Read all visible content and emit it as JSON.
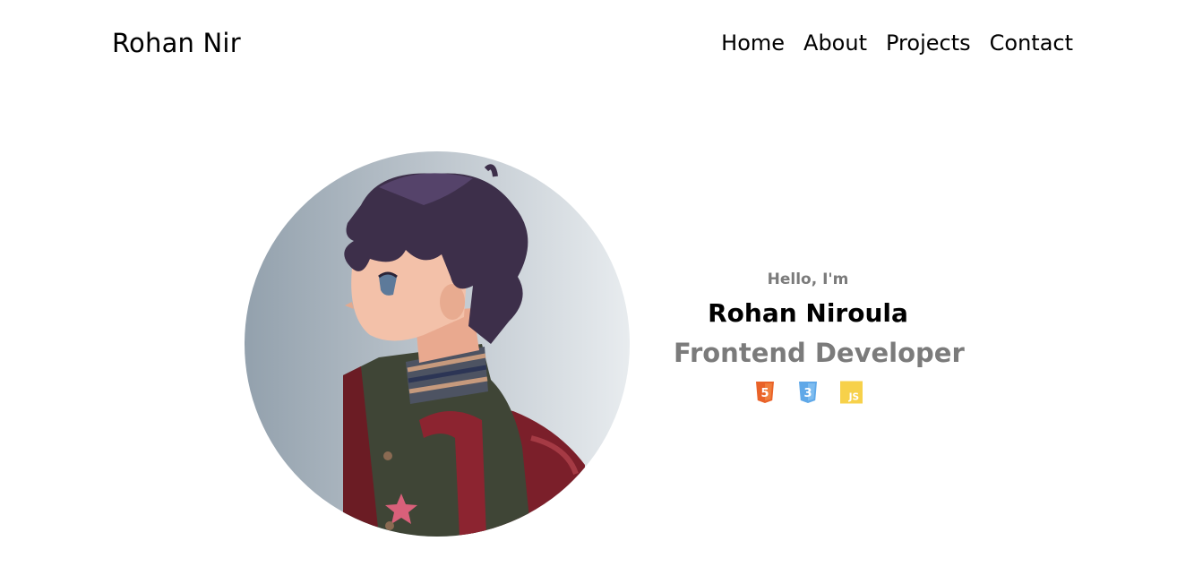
{
  "header": {
    "brand": "Rohan Nir",
    "nav": [
      {
        "label": "Home"
      },
      {
        "label": "About"
      },
      {
        "label": "Projects"
      },
      {
        "label": "Contact"
      }
    ]
  },
  "hero": {
    "avatar_icon": "anime-boy-profile-illustration",
    "greeting": "Hello, I'm",
    "name": "Rohan Niroula",
    "role": "Frontend Developer",
    "skills": [
      {
        "icon": "html5-icon",
        "label": "5",
        "color": "#e96228"
      },
      {
        "icon": "css3-icon",
        "label": "3",
        "color": "#5fa8e8"
      },
      {
        "icon": "javascript-icon",
        "label": "JS",
        "color": "#f7d14a"
      }
    ]
  }
}
